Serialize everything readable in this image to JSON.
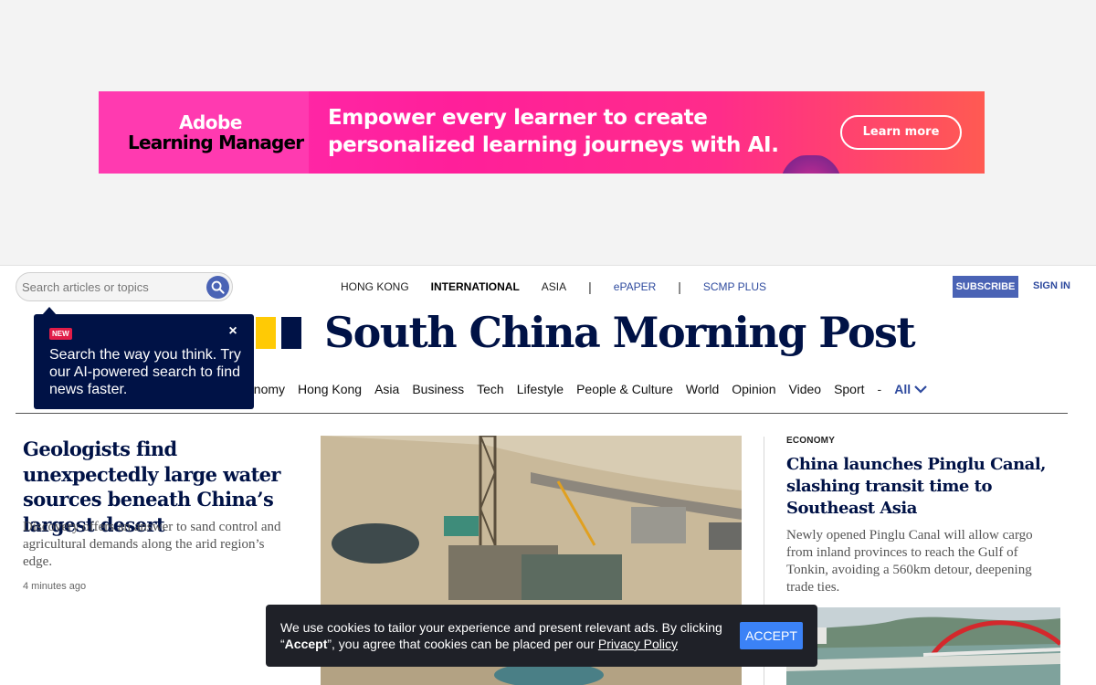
{
  "ad": {
    "logo_line1": "Adobe",
    "logo_line2": "Learning Manager",
    "headline": "Empower every learner to create personalized learning journeys with AI.",
    "cta": "Learn more"
  },
  "header": {
    "search_placeholder": "Search articles or topics",
    "editions": [
      {
        "label": "HONG KONG",
        "active": false
      },
      {
        "label": "INTERNATIONAL",
        "active": true
      },
      {
        "label": "ASIA",
        "active": false
      }
    ],
    "separator": "|",
    "epaper": "ePAPER",
    "scmp_plus": "SCMP PLUS",
    "subscribe": "SUBSCRIBE",
    "sign_in": "SIGN IN"
  },
  "masthead": {
    "title": "South China Morning Post",
    "brand_colors": {
      "yellow": "#ffca05",
      "navy": "#001246"
    }
  },
  "nav": {
    "items": [
      "onomy",
      "Hong Kong",
      "Asia",
      "Business",
      "Tech",
      "Lifestyle",
      "People & Culture",
      "World",
      "Opinion",
      "Video",
      "Sport"
    ],
    "dash": "-",
    "all": "All"
  },
  "tooltip": {
    "badge": "NEW",
    "close": "×",
    "message": "Search the way you think. Try our AI-powered search to find news faster."
  },
  "lead_story": {
    "title": "Geologists find unexpectedly large water sources beneath China’s largest desert",
    "summary": "Discovery offers an answer to sand control and agricultural demands along the arid region’s edge.",
    "time": "4 minutes ago"
  },
  "right_story": {
    "tag": "ECONOMY",
    "title": "China launches Pinglu Canal, slashing transit time to Southeast Asia",
    "summary": "Newly opened Pinglu Canal will allow cargo from inland provinces to reach the Gulf of Tonkin, avoiding a 560km detour, deepening trade ties."
  },
  "cookie": {
    "text_before": "We use cookies to tailor your experience and present relevant ads. By clicking “",
    "accept_bold": "Accept",
    "text_middle": "”, you agree that cookies can be placed per our ",
    "privacy_link": "Privacy Policy",
    "accept_button": "ACCEPT"
  }
}
